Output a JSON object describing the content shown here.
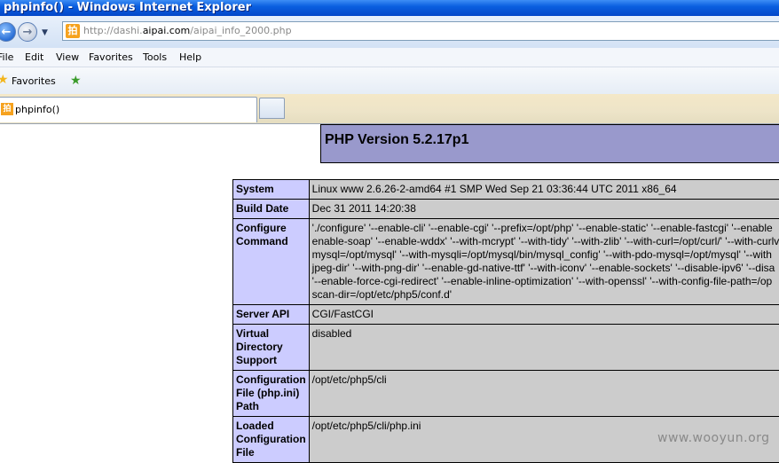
{
  "window": {
    "title": "phpinfo() - Windows Internet Explorer"
  },
  "address": {
    "url_prefix": "http://dashi.",
    "url_domain": "aipai.com",
    "url_suffix": "/aipai_info_2000.php",
    "favicon_glyph": "拍",
    "dropdown_glyph": "▼"
  },
  "menu": {
    "items": [
      "File",
      "Edit",
      "View",
      "Favorites",
      "Tools",
      "Help"
    ]
  },
  "favorites_bar": {
    "label": "Favorites"
  },
  "tabs": [
    {
      "label": "phpinfo()",
      "icon_glyph": "拍"
    }
  ],
  "page": {
    "header": "PHP Version 5.2.17p1",
    "rows": [
      {
        "key": "System",
        "value": [
          "Linux www 2.6.26-2-amd64 #1 SMP Wed Sep 21 03:36:44 UTC 2011 x86_64"
        ]
      },
      {
        "key": "Build Date",
        "value": [
          "Dec 31 2011 14:20:38"
        ]
      },
      {
        "key": "Configure Command",
        "value": [
          "'./configure' '--enable-cli' '--enable-cgi' '--prefix=/opt/php' '--enable-static' '--enable-fastcgi' '--enable",
          "enable-soap' '--enable-wddx' '--with-mcrypt' '--with-tidy' '--with-zlib' '--with-curl=/opt/curl/' '--with-curlv",
          "mysql=/opt/mysql' '--with-mysqli=/opt/mysql/bin/mysql_config' '--with-pdo-mysql=/opt/mysql' '--with",
          "jpeg-dir' '--with-png-dir' '--enable-gd-native-ttf' '--with-iconv' '--enable-sockets' '--disable-ipv6' '--disa",
          "'--enable-force-cgi-redirect' '--enable-inline-optimization' '--with-openssl' '--with-config-file-path=/op",
          "scan-dir=/opt/etc/php5/conf.d'"
        ]
      },
      {
        "key": "Server API",
        "value": [
          "CGI/FastCGI"
        ]
      },
      {
        "key": "Virtual Directory Support",
        "value": [
          "disabled"
        ]
      },
      {
        "key": "Configuration File (php.ini) Path",
        "value": [
          "/opt/etc/php5/cli"
        ]
      },
      {
        "key": "Loaded Configuration File",
        "value": [
          "/opt/etc/php5/cli/php.ini"
        ]
      }
    ]
  },
  "watermark": "www.wooyun.org",
  "colors": {
    "title_bar": "#0a5fe0",
    "php_header": "#9999cc",
    "key_cell": "#ccccff",
    "value_cell": "#cccccc"
  }
}
